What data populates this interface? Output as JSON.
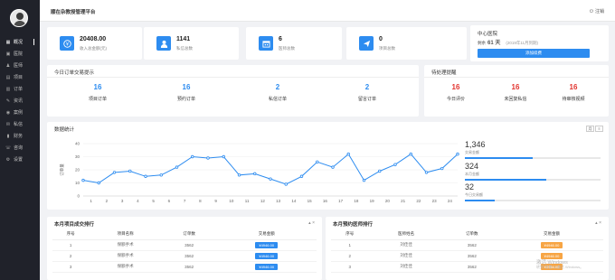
{
  "topbar": {
    "title": "顺在杂教授管理平台",
    "logout": "注销"
  },
  "sidebar": {
    "items": [
      {
        "label": "概况",
        "icon": "grid-icon",
        "glyph": "▦"
      },
      {
        "label": "医院",
        "icon": "hospital-icon",
        "glyph": "▣"
      },
      {
        "label": "医师",
        "icon": "doctor-icon",
        "glyph": "♟"
      },
      {
        "label": "项目",
        "icon": "project-icon",
        "glyph": "▤"
      },
      {
        "label": "订单",
        "icon": "order-icon",
        "glyph": "▥"
      },
      {
        "label": "资讯",
        "icon": "news-icon",
        "glyph": "✎"
      },
      {
        "label": "案例",
        "icon": "case-icon",
        "glyph": "◉"
      },
      {
        "label": "私信",
        "icon": "message-icon",
        "glyph": "✉"
      },
      {
        "label": "财务",
        "icon": "finance-icon",
        "glyph": "▮"
      },
      {
        "label": "咨询",
        "icon": "consult-icon",
        "glyph": "☏"
      },
      {
        "label": "设置",
        "icon": "settings-icon",
        "glyph": "⚙"
      }
    ]
  },
  "stats": [
    {
      "value": "20408.00",
      "label": "收入总金额(元)",
      "icon": "wallet-icon",
      "glyph": "¥"
    },
    {
      "value": "1141",
      "label": "私信总数",
      "icon": "user-icon",
      "glyph": "👤"
    },
    {
      "value": "6",
      "label": "医师总数",
      "icon": "calendar-icon",
      "glyph": "▦"
    },
    {
      "value": "0",
      "label": "项目总数",
      "icon": "send-icon",
      "glyph": "➤"
    }
  ],
  "center": {
    "title": "中心医院",
    "remaining_label": "剩余",
    "days": "61 天",
    "expire": "(2019年11月到期)",
    "renew": "添加续费"
  },
  "quick": {
    "title": "今日订单交易提示",
    "items": [
      {
        "value": "16",
        "label": "项目订单"
      },
      {
        "value": "16",
        "label": "预约订单"
      },
      {
        "value": "2",
        "label": "私信订单"
      },
      {
        "value": "2",
        "label": "留言订单"
      }
    ]
  },
  "pending": {
    "title": "待处理提醒",
    "items": [
      {
        "value": "16",
        "label": "今日评价"
      },
      {
        "value": "16",
        "label": "未回复私信"
      },
      {
        "value": "16",
        "label": "待审核视频"
      }
    ]
  },
  "chart_data": {
    "type": "line",
    "title": "数据统计",
    "ylabel": "订单量",
    "x": [
      1,
      2,
      3,
      4,
      5,
      6,
      7,
      8,
      9,
      10,
      11,
      12,
      13,
      14,
      15,
      16,
      17,
      18,
      19,
      20,
      21,
      22,
      23,
      24
    ],
    "values": [
      12,
      10,
      18,
      19,
      15,
      16,
      22,
      30,
      29,
      30,
      16,
      17,
      13,
      9,
      15,
      26,
      22,
      32,
      12,
      19,
      24,
      32,
      18,
      21,
      32
    ],
    "series": [
      {
        "values": [
          12,
          10,
          18,
          19,
          15,
          16,
          22,
          30,
          29,
          30,
          16,
          17,
          13,
          9,
          15,
          26,
          22,
          32,
          12,
          19,
          24,
          32,
          18,
          21,
          32
        ]
      }
    ],
    "ylim": [
      0,
      40
    ],
    "yticks": [
      0,
      10,
      20,
      30,
      40
    ],
    "grid": true,
    "color": "#2d8cf0"
  },
  "chart_tools": {
    "month": "月",
    "more": "≡"
  },
  "side_stats": [
    {
      "value": "1,346",
      "label": "交易金额",
      "pct": 0.5
    },
    {
      "value": "324",
      "label": "本月金额",
      "pct": 0.6
    },
    {
      "value": "32",
      "label": "今日交易额",
      "pct": 0.22
    }
  ],
  "project_table": {
    "title": "本月项目成交排行",
    "tools": "▴ ×",
    "headers": [
      "序号",
      "项目名称",
      "订单数",
      "交易金额"
    ],
    "rows": [
      [
        "1",
        "保额手术",
        "3562",
        "¥4946.00"
      ],
      [
        "2",
        "保额手术",
        "3562",
        "¥4946.00"
      ],
      [
        "3",
        "保额手术",
        "3562",
        "¥4946.00"
      ]
    ]
  },
  "doctor_table": {
    "title": "本月预约医师排行",
    "tools": "▴ ×",
    "headers": [
      "序号",
      "医师姓名",
      "订单数",
      "交易金额"
    ],
    "rows": [
      [
        "1",
        "刘佳佳",
        "3562",
        "¥4946.00"
      ],
      [
        "2",
        "刘佳佳",
        "3562",
        "¥4946.00"
      ],
      [
        "3",
        "刘佳佳",
        "3562",
        "¥4946.00"
      ]
    ]
  },
  "watermark": {
    "line1": "激活 Windows",
    "line2": "转到\"设置\"以激活 Windows。"
  }
}
